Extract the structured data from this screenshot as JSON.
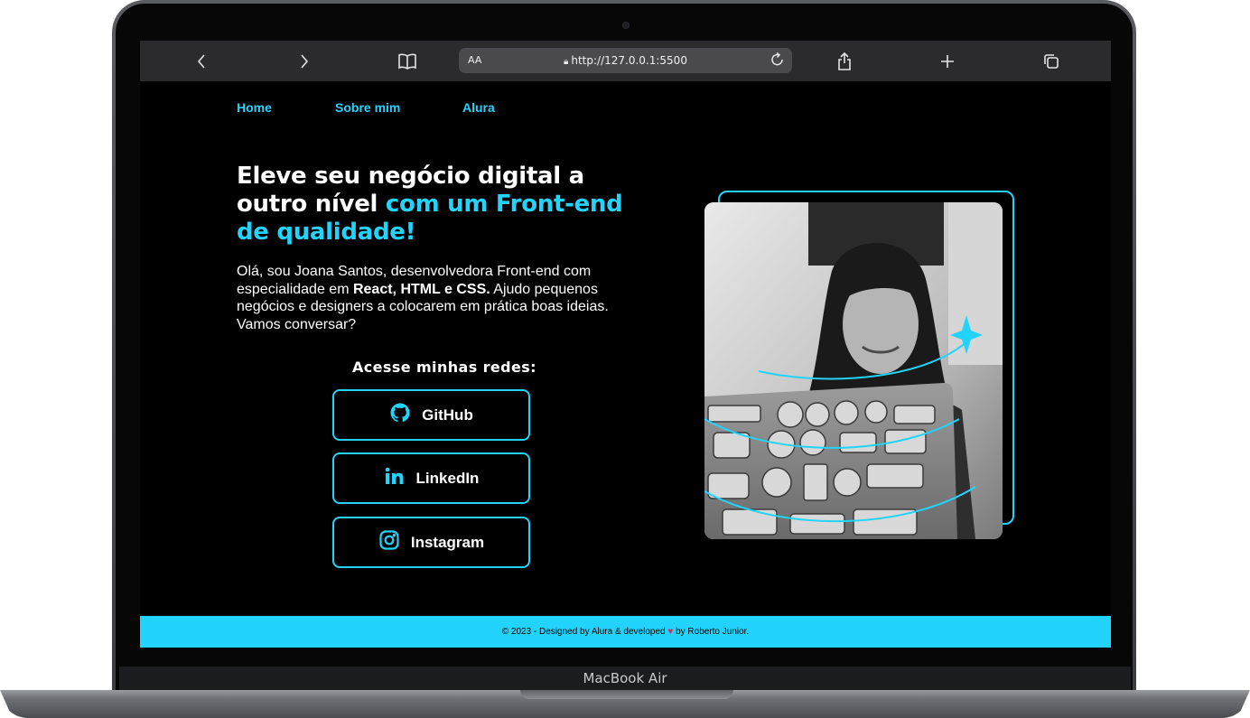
{
  "device": {
    "model_label": "MacBook Air"
  },
  "browser": {
    "text_size_label": "AA",
    "url": "http://127.0.0.1:5500",
    "icons": [
      "back-icon",
      "forward-icon",
      "bookmarks-icon",
      "lock-icon",
      "reload-icon",
      "share-icon",
      "new-tab-icon",
      "tabs-icon"
    ]
  },
  "nav": {
    "items": [
      {
        "label": "Home"
      },
      {
        "label": "Sobre mim"
      },
      {
        "label": "Alura"
      }
    ]
  },
  "hero": {
    "headline_white": "Eleve seu negócio digital a outro nível ",
    "headline_accent": "com um Front-end de qualidade!",
    "intro_1": "Olá, sou Joana Santos, desenvolvedora Front-end com especialidade em ",
    "intro_bold": "React, HTML e CSS.",
    "intro_2": " Ajudo pequenos negócios e designers a colocarem em prática boas ideias. Vamos conversar?"
  },
  "social": {
    "title": "Acesse minhas redes:",
    "buttons": [
      {
        "label": "GitHub",
        "icon": "github-icon"
      },
      {
        "label": "LinkedIn",
        "icon": "linkedin-icon"
      },
      {
        "label": "Instagram",
        "icon": "instagram-icon"
      }
    ]
  },
  "footer": {
    "text_before": "© 2023 - Designed by Alura & developed",
    "text_after": "by Roberto Junior."
  },
  "colors": {
    "accent": "#22d4fd",
    "background": "#000000",
    "text": "#ffffff"
  }
}
